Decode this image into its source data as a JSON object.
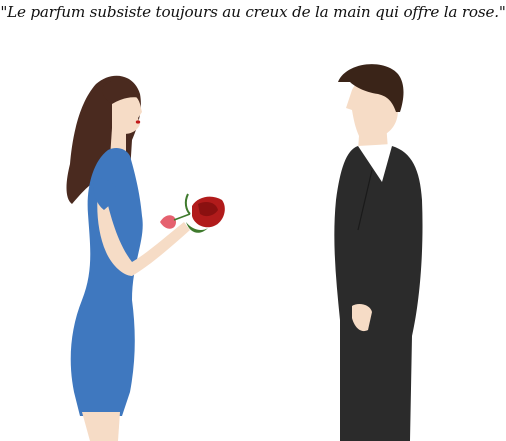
{
  "quote": {
    "text": "\"Le parfum subsiste toujours au creux de la main qui offre la rose.\""
  },
  "colors": {
    "background": "#ffffff",
    "dress": "#3f78bf",
    "hair_woman": "#4a2a1f",
    "hair_man": "#3a2418",
    "skin": "#f6dcc6",
    "suit": "#2b2b2b",
    "rose": "#b11b1b",
    "stem": "#3f7a2d"
  }
}
